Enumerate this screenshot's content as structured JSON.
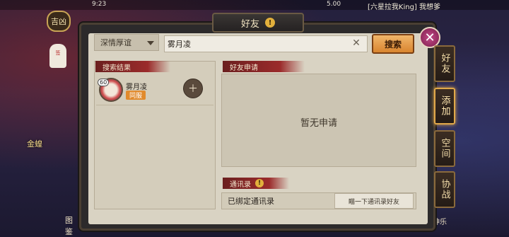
{
  "status": {
    "time": "9:23",
    "date": "5.00"
  },
  "chat_ticker": "[六星拉我King] 我想爹",
  "hud": {
    "jixiong_label": "吉凶",
    "charm_text": "签",
    "gold_label": "金蝗",
    "tujian_label": "图鉴",
    "right_label": "神乐"
  },
  "panel": {
    "title": "好友",
    "title_warn": "!"
  },
  "search": {
    "dropdown_value": "深情厚谊",
    "input_value": "雾月凌",
    "button_label": "搜索",
    "close_glyph": "✕",
    "clear_glyph": "✕"
  },
  "results": {
    "header": "搜索结果",
    "items": [
      {
        "level": "60",
        "name": "雾月凌",
        "tag": "同服"
      }
    ],
    "add_glyph": "＋"
  },
  "applications": {
    "header": "好友申请",
    "empty_text": "暂无申请"
  },
  "contacts": {
    "header": "通讯录",
    "warn": "!",
    "bound_text": "已绑定通讯录",
    "shake_button": "瞄一下通讯录好友"
  },
  "tabs": [
    {
      "label": "好友",
      "active": false
    },
    {
      "label": "添加",
      "active": true
    },
    {
      "label": "空间",
      "active": false
    },
    {
      "label": "协战",
      "active": false
    }
  ]
}
